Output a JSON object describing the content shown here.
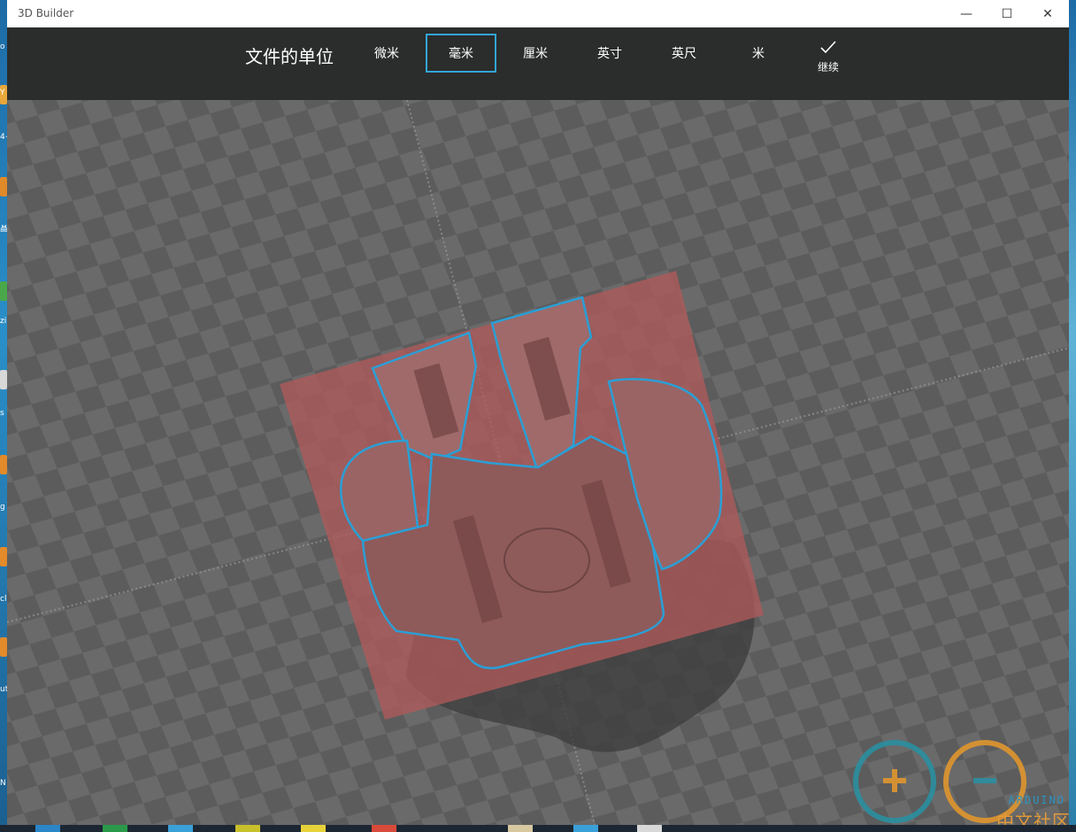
{
  "window": {
    "title": "3D Builder",
    "minimize_glyph": "—",
    "maximize_glyph": "☐",
    "close_glyph": "✕"
  },
  "toolbar": {
    "units_label": "文件的单位",
    "units": [
      "微米",
      "毫米",
      "厘米",
      "英寸",
      "英尺",
      "米"
    ],
    "selected_unit": "毫米",
    "continue_label": "继续",
    "accent": "#31a6d8"
  },
  "viewport": {
    "icon": "3d-model-preview",
    "model_tint": "#c97b7b",
    "outline_color": "#2a9fd6"
  },
  "desktop": {
    "left_glyphs": [
      "o",
      "Y",
      "4+",
      "晶",
      "zi",
      "s",
      "g",
      "cl",
      "ut",
      "N"
    ]
  },
  "watermark": {
    "brand": "ARDUINO",
    "text": "中文社区"
  }
}
